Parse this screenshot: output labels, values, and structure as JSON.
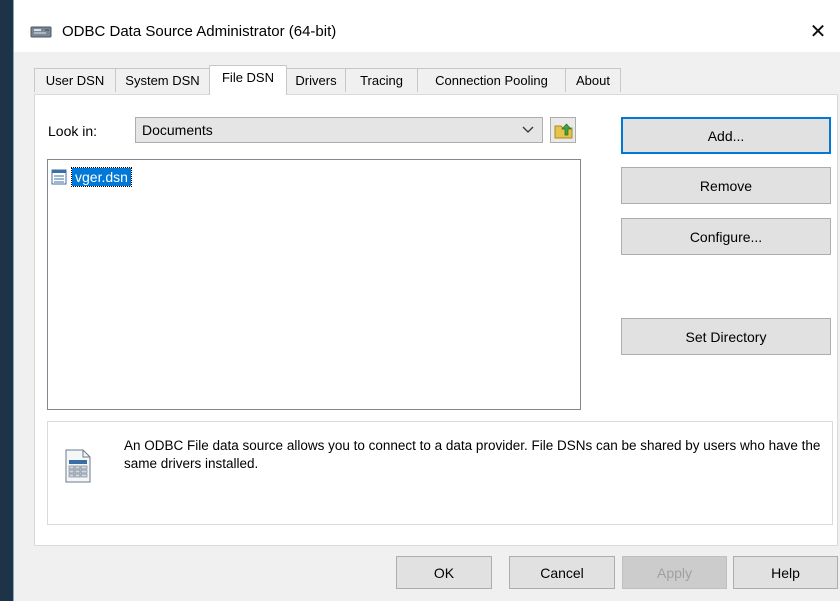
{
  "window": {
    "title": "ODBC Data Source Administrator (64-bit)"
  },
  "tabs": [
    {
      "label": "User DSN"
    },
    {
      "label": "System DSN"
    },
    {
      "label": "File DSN"
    },
    {
      "label": "Drivers"
    },
    {
      "label": "Tracing"
    },
    {
      "label": "Connection Pooling"
    },
    {
      "label": "About"
    }
  ],
  "active_tab": "File DSN",
  "file_dsn": {
    "look_in_label": "Look in:",
    "look_in_value": "Documents",
    "files": [
      {
        "name": "vger.dsn",
        "selected": true
      }
    ],
    "buttons": {
      "add": "Add...",
      "remove": "Remove",
      "configure": "Configure...",
      "set_directory": "Set Directory"
    },
    "info_text": "An ODBC File data source allows you to connect to a data provider.  File DSNs can be shared by users who have the same drivers installed."
  },
  "footer": {
    "ok": "OK",
    "cancel": "Cancel",
    "apply": "Apply",
    "help": "Help"
  },
  "icons": {
    "app": "odbc-app-icon",
    "close": "close-icon",
    "dropdown": "chevron-down-icon",
    "up_folder": "up-folder-icon",
    "file": "dsn-file-icon",
    "info": "datasource-icon"
  },
  "colors": {
    "selection": "#0078d7",
    "default_button_border": "#0078d7"
  }
}
